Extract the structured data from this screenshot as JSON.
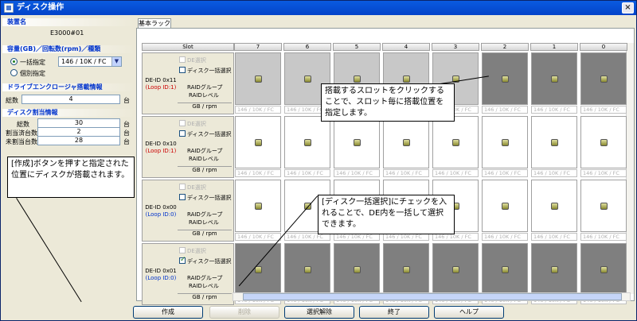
{
  "window": {
    "title": "ディスク操作",
    "close": "×"
  },
  "left": {
    "device_name_heading": "装置名",
    "device_name": "E3000#01",
    "capacity_heading": "容量(GB)／回転数(rpm)／種類",
    "batch_label": "一括指定",
    "batch_value": "146 / 10K / FC",
    "individual_label": "個別指定",
    "enclosure_heading": "ドライブエンクロージャ搭載情報",
    "total_label": "総数",
    "total_value": "4",
    "unit": "台",
    "alloc_heading": "ディスク割当情報",
    "alloc_total_label": "総数",
    "alloc_total_value": "30",
    "alloc_assigned_label": "割当済台数",
    "alloc_assigned_value": "2",
    "alloc_unassigned_label": "未割当台数",
    "alloc_unassigned_value": "28"
  },
  "tab": "基本ラック",
  "slot_header": "Slot",
  "slots": [
    "7",
    "6",
    "5",
    "4",
    "3",
    "2",
    "1",
    "0"
  ],
  "rows": [
    {
      "de": "DE-ID 0x11",
      "loop": "(Loop ID:1)",
      "loop_color": "#cc0000",
      "de_sel": "DE選択",
      "batch": "ディスク一括選択",
      "raid": "RAIDグループ",
      "raid2": "RAIDレベル",
      "gb": "GB / rpm",
      "checked": false
    },
    {
      "de": "DE-ID 0x10",
      "loop": "(Loop ID:1)",
      "loop_color": "#cc0000",
      "de_sel": "DE選択",
      "batch": "ディスク一括選択",
      "raid": "RAIDグループ",
      "raid2": "RAIDレベル",
      "gb": "GB / rpm",
      "checked": false
    },
    {
      "de": "DE-ID 0x00",
      "loop": "(Loop ID:0)",
      "loop_color": "#0033cc",
      "de_sel": "DE選択",
      "batch": "ディスク一括選択",
      "raid": "RAIDグループ",
      "raid2": "RAIDレベル",
      "gb": "GB / rpm",
      "checked": false
    },
    {
      "de": "DE-ID 0x01",
      "loop": "(Loop ID:0)",
      "loop_color": "#0033cc",
      "de_sel": "DE選択",
      "batch": "ディスク一括選択",
      "raid": "RAIDグループ",
      "raid2": "RAIDレベル",
      "gb": "GB / rpm",
      "checked": true
    }
  ],
  "dropdown_value": "146 / 10K / FC",
  "buttons": {
    "create": "作成",
    "delete": "削除",
    "clear": "選択解除",
    "finish": "終了",
    "help": "ヘルプ"
  },
  "callouts": {
    "c1": "搭載するスロットをクリックすることで、スロット毎に搭載位置を指定します。",
    "c2": "[作成]ボタンを押すと指定された位置にディスクが搭載されます。",
    "c3": "[ディスク一括選択]にチェックを入れることで、DE内を一括して選択できます。"
  }
}
